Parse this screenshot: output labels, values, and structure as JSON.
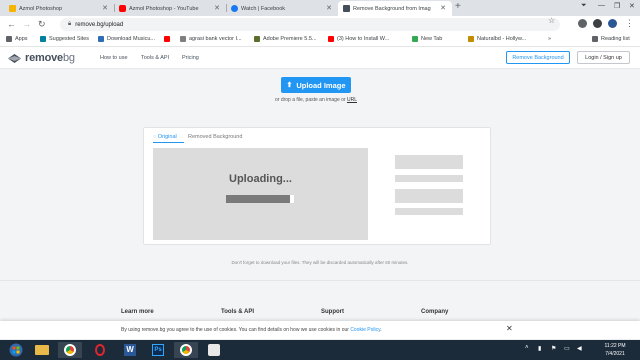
{
  "browser": {
    "tabs": [
      {
        "title": "Azmol Photoshop",
        "favicon_color": "#f5b400",
        "active": false
      },
      {
        "title": "Azmol Photoshop - YouTube",
        "favicon_color": "#ff0000",
        "active": false
      },
      {
        "title": "Watch | Facebook",
        "favicon_color": "#1877f2",
        "active": false
      },
      {
        "title": "Remove Background from Imag",
        "favicon_color": "#454f5b",
        "active": true
      }
    ],
    "url": "remove.bg/upload",
    "bookmarks": [
      {
        "label": "Apps",
        "icon": "apps-grid-icon",
        "color": "#5f6368"
      },
      {
        "label": "Suggested Sites",
        "icon": "bing-icon",
        "color": "#00809d"
      },
      {
        "label": "Download Musicu...",
        "icon": "music-icon",
        "color": "#2f6db5"
      },
      {
        "label": "",
        "icon": "youtube-icon",
        "color": "#ff0000"
      },
      {
        "label": "agrasi bank vector I...",
        "icon": "vector-icon",
        "color": "#7f7f7f"
      },
      {
        "label": "Adobe Premiere 5.5...",
        "icon": "premiere-icon",
        "color": "#5a6f2d"
      },
      {
        "label": "(3) How to Install W...",
        "icon": "youtube-icon",
        "color": "#ff0000"
      },
      {
        "label": "New Tab",
        "icon": "play-store-icon",
        "color": "#34a853"
      },
      {
        "label": "Naturalbd - Hollyw...",
        "icon": "site-icon",
        "color": "#c28b00"
      }
    ],
    "reading_list": "Reading list"
  },
  "site": {
    "logo_main": "remove",
    "logo_suffix": "bg",
    "nav": [
      "How to use",
      "Tools & API",
      "Pricing"
    ],
    "remove_background_btn": "Remove Background",
    "login_btn": "Login / Sign up",
    "accent": "#2196f3"
  },
  "upload": {
    "button_label": "Upload Image",
    "drop_text_prefix": "or drop a file, paste an image or ",
    "drop_text_link": "URL"
  },
  "result": {
    "tab_original": "Original",
    "tab_removed": "Removed Background",
    "status": "Uploading...",
    "progress": 0.94
  },
  "notice": "Don't forget to download your files. They will be discarded automatically after 60 minutes.",
  "footer": {
    "headings": [
      "Learn more",
      "Tools & API",
      "Support",
      "Company"
    ]
  },
  "cookie": {
    "text": "By using remove.bg you agree to the use of cookies. You can find details on how we use cookies in our ",
    "link": "Cookie Policy",
    "end": "."
  },
  "taskbar": {
    "time": "11:22 PM",
    "date": "7/4/2021"
  }
}
